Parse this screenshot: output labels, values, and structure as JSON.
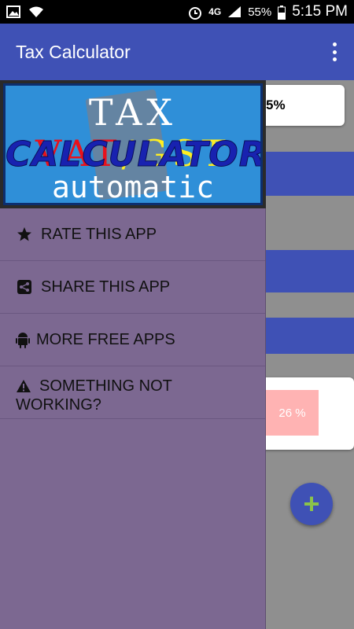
{
  "status_bar": {
    "network": "4G",
    "battery": "55%",
    "time": "5:15 PM"
  },
  "app_bar": {
    "title": "Tax Calculator"
  },
  "background": {
    "card_text": "5%",
    "percent_box": "26 %",
    "fab_symbol": "+"
  },
  "drawer": {
    "banner": {
      "line1_tax": "TAX ",
      "line1_vat": "VAT",
      "line1_gst": "/GST",
      "line2": "CALCULATOR",
      "line3": "automatic"
    },
    "items": [
      {
        "label": "RATE THIS APP",
        "icon": "star-icon"
      },
      {
        "label": "SHARE THIS APP",
        "icon": "share-icon"
      },
      {
        "label": "MORE FREE APPS",
        "icon": "android-icon"
      },
      {
        "label": "SOMETHING NOT WORKING?",
        "icon": "warning-icon"
      }
    ]
  },
  "colors": {
    "primary": "#3f51b5",
    "drawer": "#7c6891",
    "fab_plus": "#8bc34a"
  }
}
